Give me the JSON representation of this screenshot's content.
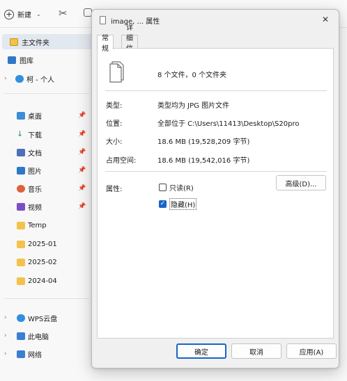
{
  "explorer": {
    "toolbar": {
      "new_label": "新建"
    },
    "sidebar": {
      "top_items": [
        {
          "label": "主文件夹"
        },
        {
          "label": "图库"
        },
        {
          "label": "柯 - 个人"
        }
      ],
      "quick_access": [
        {
          "label": "桌面",
          "icon": "desktop-icon",
          "color": "#3a8ed8"
        },
        {
          "label": "下载",
          "icon": "download-icon",
          "color": "#2f8f6a"
        },
        {
          "label": "文档",
          "icon": "document-icon",
          "color": "#4f6fb8"
        },
        {
          "label": "图片",
          "icon": "picture-icon",
          "color": "#2f78c8"
        },
        {
          "label": "音乐",
          "icon": "music-icon",
          "color": "#e0613a"
        },
        {
          "label": "视频",
          "icon": "video-icon",
          "color": "#7b4fc2"
        },
        {
          "label": "Temp",
          "icon": "folder-icon",
          "color": "#f2c24a"
        },
        {
          "label": "2025-01",
          "icon": "folder-icon",
          "color": "#f2c24a"
        },
        {
          "label": "2025-02",
          "icon": "folder-icon",
          "color": "#f2c24a"
        },
        {
          "label": "2024-04",
          "icon": "folder-icon",
          "color": "#f2c24a"
        }
      ],
      "bottom_items": [
        {
          "label": "WPS云盘",
          "icon": "cloud-icon",
          "color": "#2f8fe0"
        },
        {
          "label": "此电脑",
          "icon": "computer-icon",
          "color": "#3a7fd0"
        },
        {
          "label": "网络",
          "icon": "network-icon",
          "color": "#3a7fd0"
        }
      ]
    }
  },
  "dialog": {
    "title": "image, ... 属性",
    "close_glyph": "✕",
    "tabs": [
      {
        "label": "常规",
        "active": true
      },
      {
        "label": "详细信息",
        "active": false
      }
    ],
    "summary": "8 个文件，0 个文件夹",
    "properties": [
      {
        "label": "类型:",
        "value": "类型均为 JPG 图片文件"
      },
      {
        "label": "位置:",
        "value": "全部位于 C:\\Users\\11413\\Desktop\\S20pro"
      },
      {
        "label": "大小:",
        "value": "18.6 MB (19,528,209 字节)"
      },
      {
        "label": "占用空间:",
        "value": "18.6 MB (19,542,016 字节)"
      }
    ],
    "attributes_label": "属性:",
    "readonly": {
      "label": "只读(R)",
      "checked": false
    },
    "hidden": {
      "label": "隐藏(H)",
      "checked": true
    },
    "advanced_button": "高级(D)...",
    "buttons": {
      "ok": "确定",
      "cancel": "取消",
      "apply": "应用(A)"
    }
  },
  "colors": {
    "accent": "#1a64c8",
    "folder": "#f2c24a"
  }
}
